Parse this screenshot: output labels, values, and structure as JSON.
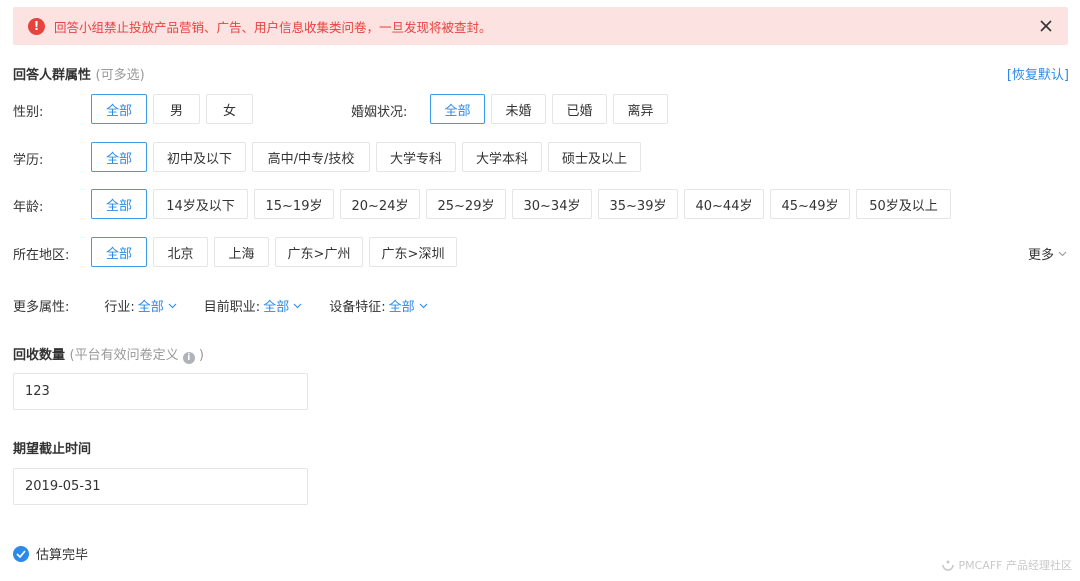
{
  "alert": {
    "icon": "exclamation-icon",
    "text": "回答小组禁止投放产品营销、广告、用户信息收集类问卷，一旦发现将被查封。",
    "close_icon": "close-icon",
    "color": "#e8423f"
  },
  "audience": {
    "title": "回答人群属性",
    "hint": "(可多选)",
    "restore": "[恢复默认]"
  },
  "gender": {
    "label": "性别:",
    "options": [
      "全部",
      "男",
      "女"
    ]
  },
  "marital": {
    "label": "婚姻状况:",
    "options": [
      "全部",
      "未婚",
      "已婚",
      "离异"
    ]
  },
  "education": {
    "label": "学历:",
    "options": [
      "全部",
      "初中及以下",
      "高中/中专/技校",
      "大学专科",
      "大学本科",
      "硕士及以上"
    ]
  },
  "age": {
    "label": "年龄:",
    "options": [
      "全部",
      "14岁及以下",
      "15~19岁",
      "20~24岁",
      "25~29岁",
      "30~34岁",
      "35~39岁",
      "40~44岁",
      "45~49岁",
      "50岁及以上"
    ]
  },
  "region": {
    "label": "所在地区:",
    "options": [
      "全部",
      "北京",
      "上海",
      "广东>广州",
      "广东>深圳"
    ],
    "more": "更多"
  },
  "more_attrs": {
    "label": "更多属性:",
    "items": [
      {
        "name": "行业:",
        "value": "全部"
      },
      {
        "name": "目前职业:",
        "value": "全部"
      },
      {
        "name": "设备特征:",
        "value": "全部"
      }
    ]
  },
  "quantity": {
    "title": "回收数量",
    "hint_open": "(平台有效问卷定义",
    "hint_close": ")",
    "value": "123"
  },
  "deadline": {
    "title": "期望截止时间",
    "value": "2019-05-31"
  },
  "estimate": {
    "label": "估算完毕"
  },
  "watermark": "PMCAFF 产品经理社区",
  "colors": {
    "accent": "#2b8ae8",
    "alert_bg": "#fde2e2",
    "alert_text": "#e8423f"
  }
}
